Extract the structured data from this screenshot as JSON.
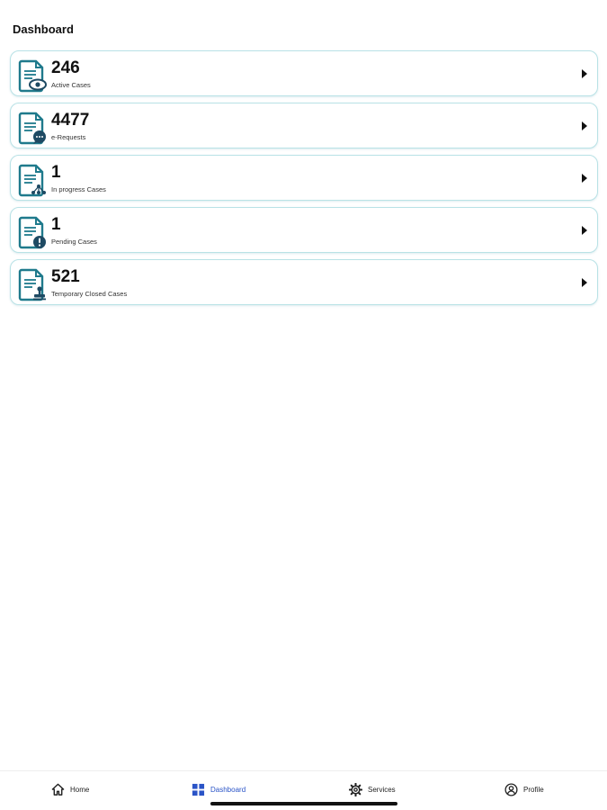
{
  "header": {
    "title": "Dashboard"
  },
  "cards": [
    {
      "count": "246",
      "label": "Active Cases",
      "icon": "document-eye-icon"
    },
    {
      "count": "4477",
      "label": "e-Requests",
      "icon": "document-chat-icon"
    },
    {
      "count": "1",
      "label": "In progress Cases",
      "icon": "document-progress-icon"
    },
    {
      "count": "1",
      "label": "Pending Cases",
      "icon": "document-alert-icon"
    },
    {
      "count": "521",
      "label": "Temporary Closed Cases",
      "icon": "document-stamp-icon"
    }
  ],
  "tabbar": {
    "home": "Home",
    "dashboard": "Dashboard",
    "services": "Services",
    "profile": "Profile",
    "active": "Dashboard"
  },
  "colors": {
    "card_border": "#b9e2e6",
    "icon_teal": "#1f7a8c",
    "icon_dark": "#1e4a63",
    "tab_active": "#2a54c7"
  }
}
